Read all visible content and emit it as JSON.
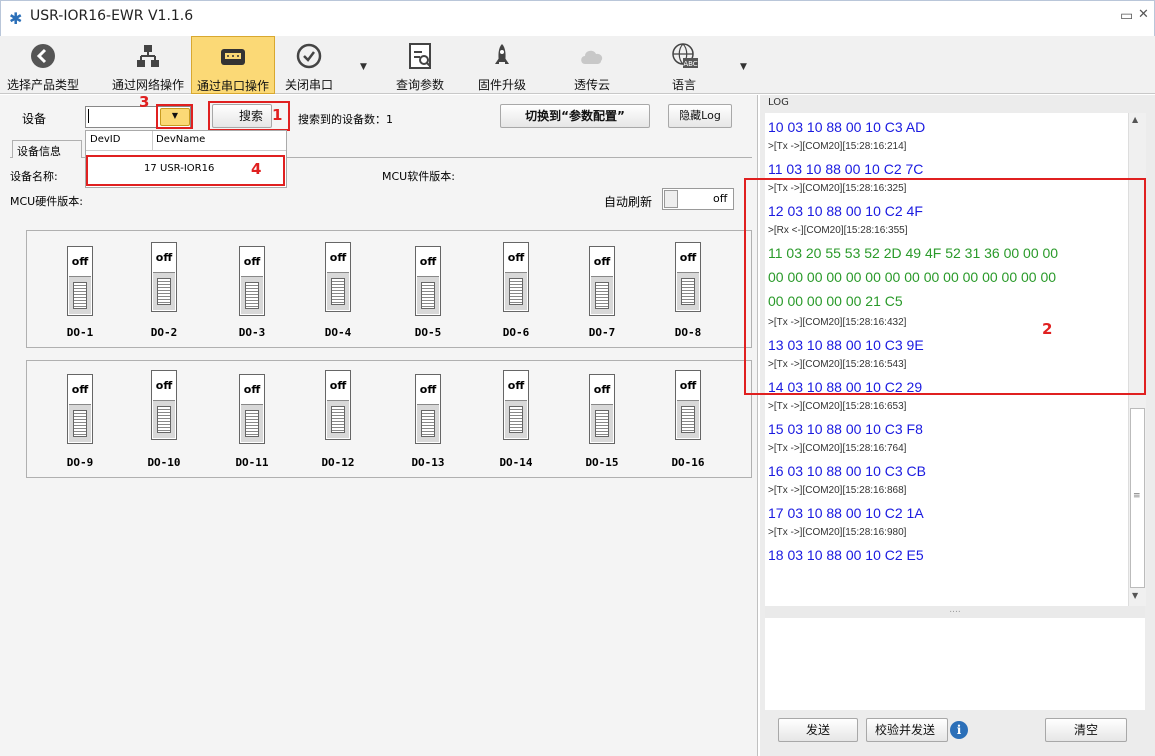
{
  "window": {
    "title": "USR-IOR16-EWR V1.1.6"
  },
  "toolbar": {
    "items": [
      {
        "label": "选择产品类型"
      },
      {
        "label": "通过网络操作"
      },
      {
        "label": "通过串口操作"
      },
      {
        "label": "关闭串口"
      },
      {
        "label": "查询参数"
      },
      {
        "label": "固件升级"
      },
      {
        "label": "透传云"
      },
      {
        "label": "语言"
      }
    ],
    "lang_icon_text": "ABC"
  },
  "device_bar": {
    "device_label": "设备",
    "search_label": "搜索",
    "found_text": "搜索到的设备数：1",
    "switch_config_label": "切换到“参数配置”",
    "hide_log_label": "隐藏Log"
  },
  "dropdown": {
    "col_devid": "DevID",
    "col_devname": "DevName",
    "row_devid": "17",
    "row_devname": "USR-IOR16"
  },
  "info": {
    "tab_label": "设备信息",
    "device_name_label": "设备名称:",
    "mcu_soft_label": "MCU软件版本:",
    "mcu_hard_label": "MCU硬件版本:",
    "auto_refresh_label": "自动刷新",
    "auto_refresh_state": "off"
  },
  "annotations": [
    "1",
    "2",
    "3",
    "4"
  ],
  "switches": [
    {
      "label": "DO-1",
      "state": "off"
    },
    {
      "label": "DO-2",
      "state": "off"
    },
    {
      "label": "DO-3",
      "state": "off"
    },
    {
      "label": "DO-4",
      "state": "off"
    },
    {
      "label": "DO-5",
      "state": "off"
    },
    {
      "label": "DO-6",
      "state": "off"
    },
    {
      "label": "DO-7",
      "state": "off"
    },
    {
      "label": "DO-8",
      "state": "off"
    },
    {
      "label": "DO-9",
      "state": "off"
    },
    {
      "label": "DO-10",
      "state": "off"
    },
    {
      "label": "DO-11",
      "state": "off"
    },
    {
      "label": "DO-12",
      "state": "off"
    },
    {
      "label": "DO-13",
      "state": "off"
    },
    {
      "label": "DO-14",
      "state": "off"
    },
    {
      "label": "DO-15",
      "state": "off"
    },
    {
      "label": "DO-16",
      "state": "off"
    }
  ],
  "log": {
    "title": "LOG",
    "lines": [
      {
        "text": "10 03 10 88 00 10 C3 AD",
        "kind": "tx"
      },
      {
        "text": ">[Tx ->][COM20][15:28:16:214]",
        "kind": "meta"
      },
      {
        "text": "11 03 10 88 00 10 C2 7C",
        "kind": "tx"
      },
      {
        "text": ">[Tx ->][COM20][15:28:16:325]",
        "kind": "meta"
      },
      {
        "text": "12 03 10 88 00 10 C2 4F",
        "kind": "tx"
      },
      {
        "text": ">[Rx <-][COM20][15:28:16:355]",
        "kind": "meta"
      },
      {
        "text": "11 03 20 55 53 52 2D 49 4F 52 31 36 00 00 00",
        "kind": "rx"
      },
      {
        "text": "00 00 00 00 00 00 00 00 00 00 00 00 00 00 00",
        "kind": "rx"
      },
      {
        "text": "00 00 00 00 00 21 C5",
        "kind": "rx"
      },
      {
        "text": ">[Tx ->][COM20][15:28:16:432]",
        "kind": "meta"
      },
      {
        "text": "13 03 10 88 00 10 C3 9E",
        "kind": "tx"
      },
      {
        "text": ">[Tx ->][COM20][15:28:16:543]",
        "kind": "meta"
      },
      {
        "text": "14 03 10 88 00 10 C2 29",
        "kind": "tx"
      },
      {
        "text": ">[Tx ->][COM20][15:28:16:653]",
        "kind": "meta"
      },
      {
        "text": "15 03 10 88 00 10 C3 F8",
        "kind": "tx"
      },
      {
        "text": ">[Tx ->][COM20][15:28:16:764]",
        "kind": "meta"
      },
      {
        "text": "16 03 10 88 00 10 C3 CB",
        "kind": "tx"
      },
      {
        "text": ">[Tx ->][COM20][15:28:16:868]",
        "kind": "meta"
      },
      {
        "text": "17 03 10 88 00 10 C2 1A",
        "kind": "tx"
      },
      {
        "text": ">[Tx ->][COM20][15:28:16:980]",
        "kind": "meta"
      },
      {
        "text": "18 03 10 88 00 10 C2 E5",
        "kind": "tx"
      }
    ],
    "splitter_dots": "....",
    "send_label": "发送",
    "checksum_send_label": "校验并发送",
    "clear_label": "清空"
  },
  "colors": {
    "tx": "#1a1ae0",
    "rx": "#2a9a2a",
    "meta": "#333333",
    "accent": "#fbd976",
    "annotation": "#e02020"
  }
}
